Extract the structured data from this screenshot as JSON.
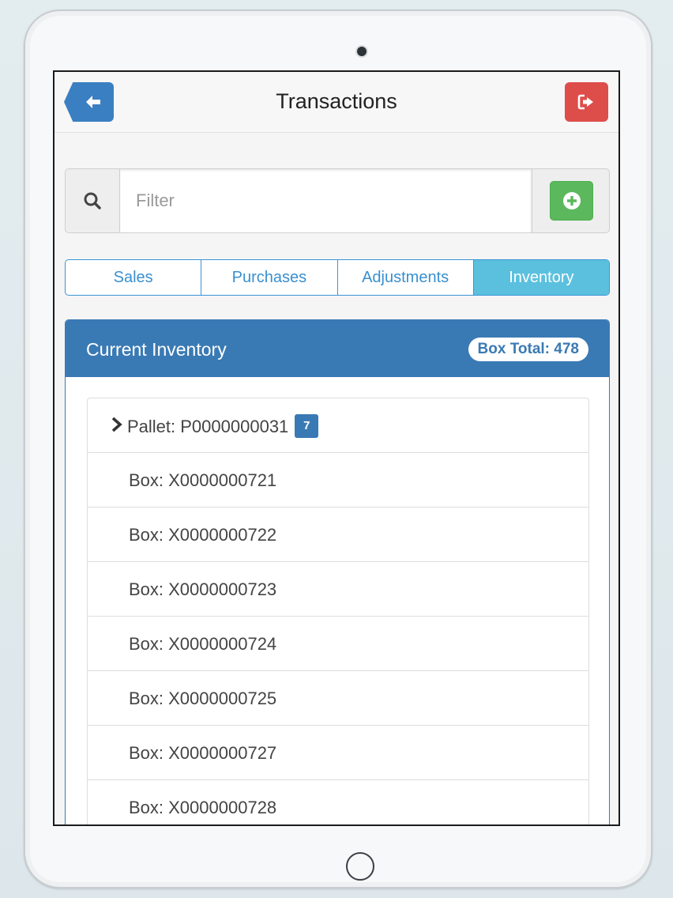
{
  "header": {
    "title": "Transactions",
    "back_icon": "arrow-left-icon",
    "logout_icon": "sign-out-icon",
    "back_color": "#3a7fc1",
    "logout_color": "#dd4e4b"
  },
  "search": {
    "placeholder": "Filter",
    "value": "",
    "search_icon": "search-icon",
    "add_icon": "plus-circle-icon",
    "add_color": "#5cb85c"
  },
  "tabs": [
    {
      "label": "Sales",
      "active": false
    },
    {
      "label": "Purchases",
      "active": false
    },
    {
      "label": "Adjustments",
      "active": false
    },
    {
      "label": "Inventory",
      "active": true
    }
  ],
  "panel": {
    "title": "Current Inventory",
    "box_total": "Box Total: 478",
    "heading_color": "#3a7ab4"
  },
  "pallet": {
    "label": "Pallet: P0000000031",
    "count": "7",
    "icon": "chevron-right-icon"
  },
  "boxes": [
    "Box: X0000000721",
    "Box: X0000000722",
    "Box: X0000000723",
    "Box: X0000000724",
    "Box: X0000000725",
    "Box: X0000000727",
    "Box: X0000000728"
  ]
}
